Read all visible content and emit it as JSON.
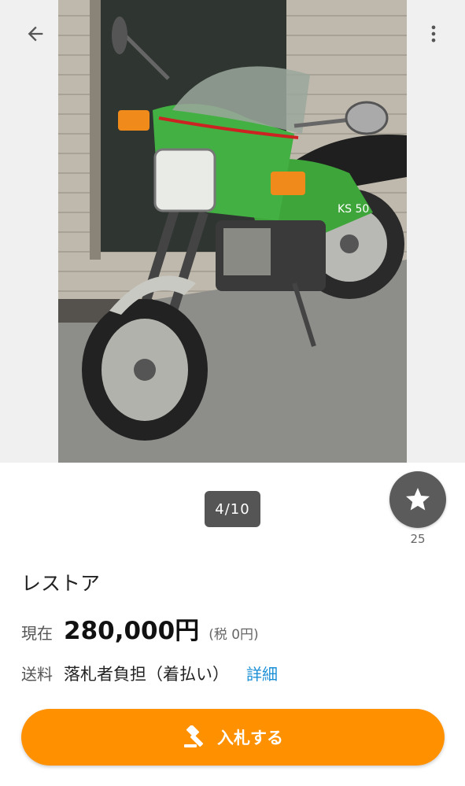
{
  "gallery": {
    "counter": "4/10",
    "image_alt": "緑色のバイク"
  },
  "favorite": {
    "count": "25"
  },
  "item": {
    "title": "レストア",
    "price_label": "現在",
    "price": "280,000円",
    "tax_note": "(税 0円)",
    "shipping_label": "送料",
    "shipping_value": "落札者負担（着払い）",
    "shipping_detail_link": "詳細"
  },
  "actions": {
    "bid_label": "入札する"
  },
  "colors": {
    "accent": "#ff9100",
    "link": "#1a8fd6"
  },
  "icons": [
    "arrow-left-icon",
    "more-vertical-icon",
    "star-icon",
    "gavel-icon"
  ]
}
